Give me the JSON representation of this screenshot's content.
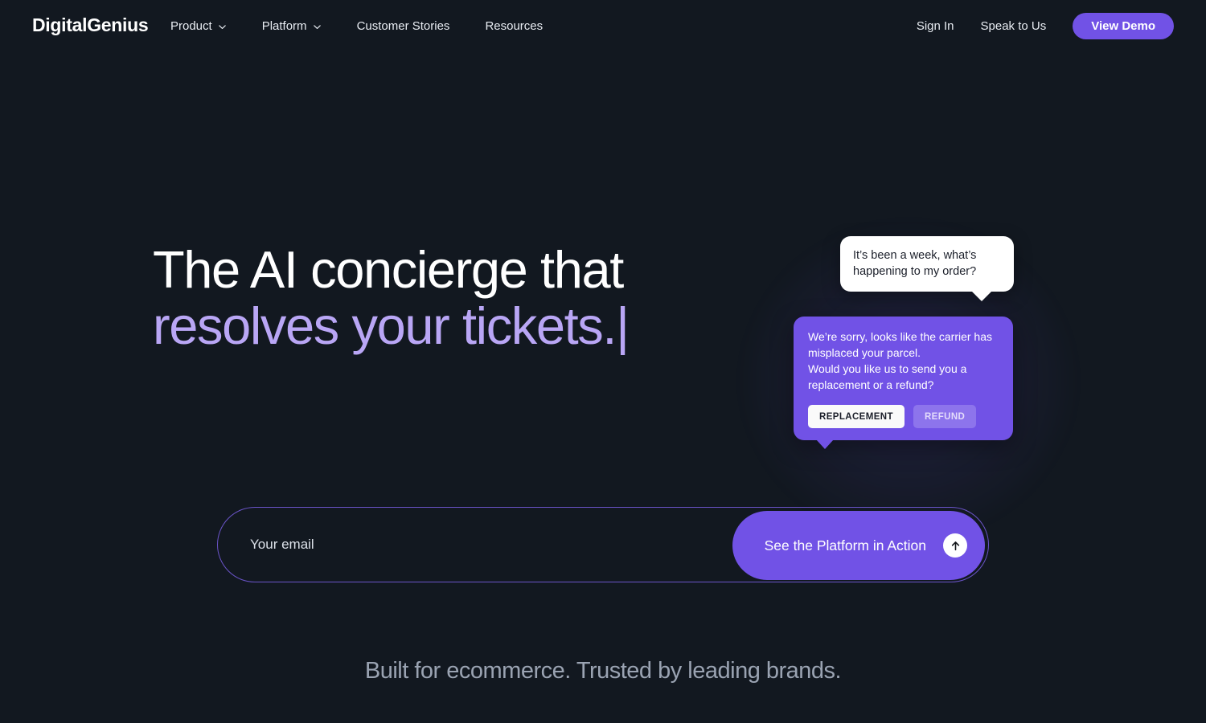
{
  "theme": {
    "background": "#121820",
    "accent": "#7152e6",
    "accent_light": "#b9a6f5",
    "text": "#ffffff",
    "muted_text": "#9aa3b2"
  },
  "navbar": {
    "logo": {
      "part1": "Digital",
      "part2": "Genius"
    },
    "links": [
      {
        "label": "Product",
        "has_dropdown": true
      },
      {
        "label": "Platform",
        "has_dropdown": true
      },
      {
        "label": "Customer Stories",
        "has_dropdown": false
      },
      {
        "label": "Resources",
        "has_dropdown": false
      }
    ],
    "sign_in": "Sign In",
    "speak_to_us": "Speak to Us",
    "view_demo": "View Demo"
  },
  "hero": {
    "headline_line1": "The AI concierge that",
    "headline_line2": "resolves your tickets.",
    "caret": "|"
  },
  "chat": {
    "user_message": "It’s been a week, what’s happening to my order?",
    "bot_message_line1": "We’re sorry, looks like the carrier has misplaced your parcel.",
    "bot_message_line2": "Would you like us to send you a replacement or a refund?",
    "quick_replies": [
      {
        "label": "REPLACEMENT",
        "style": "primary"
      },
      {
        "label": "REFUND",
        "style": "secondary"
      }
    ]
  },
  "form": {
    "email_placeholder": "Your email",
    "email_value": "",
    "cta_label": "See the Platform in Action",
    "cta_icon": "arrow-up-icon"
  },
  "tagline": "Built for ecommerce. Trusted by leading brands."
}
